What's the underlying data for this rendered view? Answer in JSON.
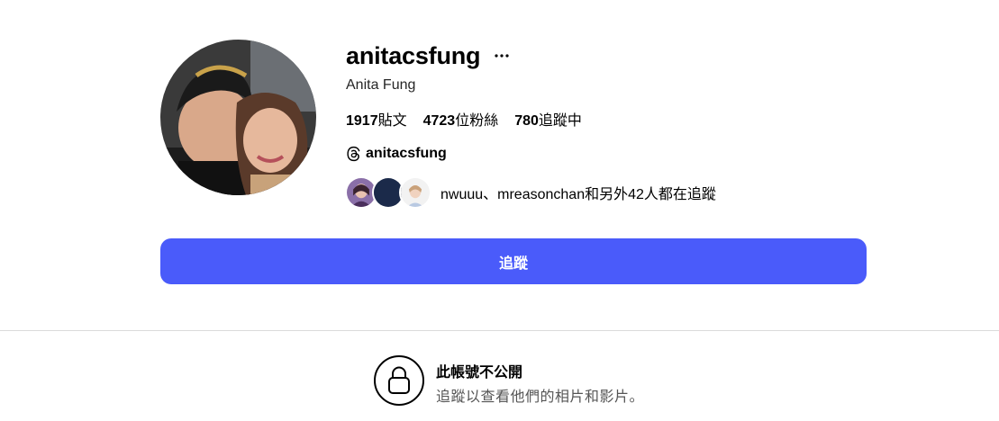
{
  "profile": {
    "username": "anitacsfung",
    "full_name": "Anita Fung",
    "more_label": "···",
    "avatar_alt": "anitacsfung 的大頭貼照",
    "stats": {
      "posts_value": "1917",
      "posts_label": "貼文",
      "followers_value": "4723",
      "followers_label": "位粉絲",
      "following_value": "780",
      "following_label": "追蹤中"
    },
    "threads_handle": "anitacsfung",
    "followed_by_text": "nwuuu、mreasonchan和另外42人都在追蹤"
  },
  "follow_button": {
    "label": "追蹤"
  },
  "private_notice": {
    "title": "此帳號不公開",
    "subtitle": "追蹤以查看他們的相片和影片。"
  },
  "colors": {
    "accent": "#4a5bfa",
    "divider": "#dbdbdb",
    "text_secondary": "#555555"
  },
  "icons": {
    "more": "more-options-icon",
    "threads": "threads-icon",
    "lock": "lock-icon"
  }
}
